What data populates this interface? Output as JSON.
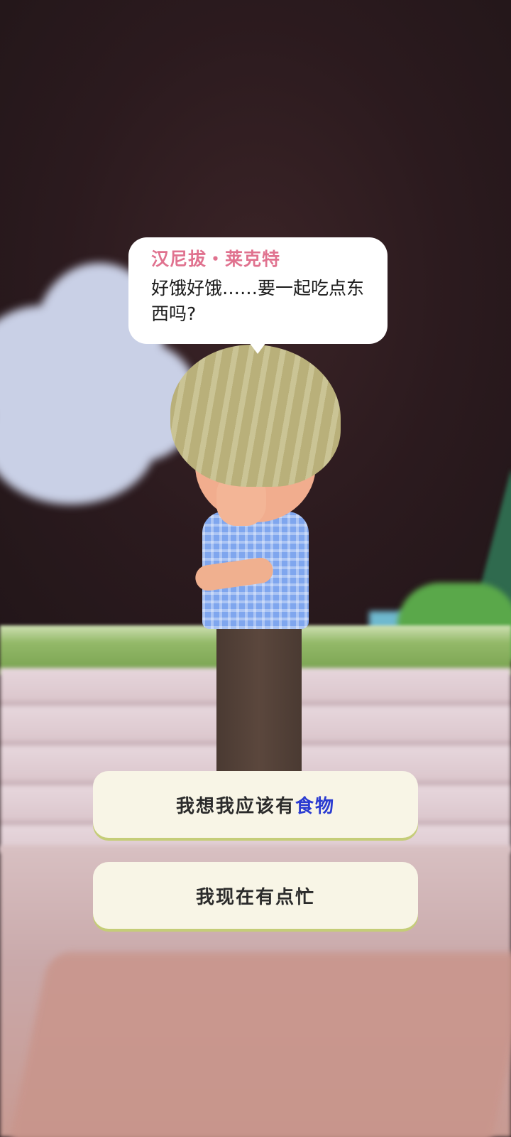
{
  "dialog": {
    "speaker": "汉尼拔・莱克特",
    "text": "好饿好饿……要一起吃点东西吗?"
  },
  "choices": [
    {
      "prefix": "我想我应该有",
      "highlight": "食物"
    },
    {
      "label": "我现在有点忙"
    }
  ],
  "colors": {
    "speaker_name": "#e0728f",
    "highlight_word": "#2a3bd1",
    "choice_background": "#f8f5e6",
    "choice_border": "#c5cd78"
  }
}
